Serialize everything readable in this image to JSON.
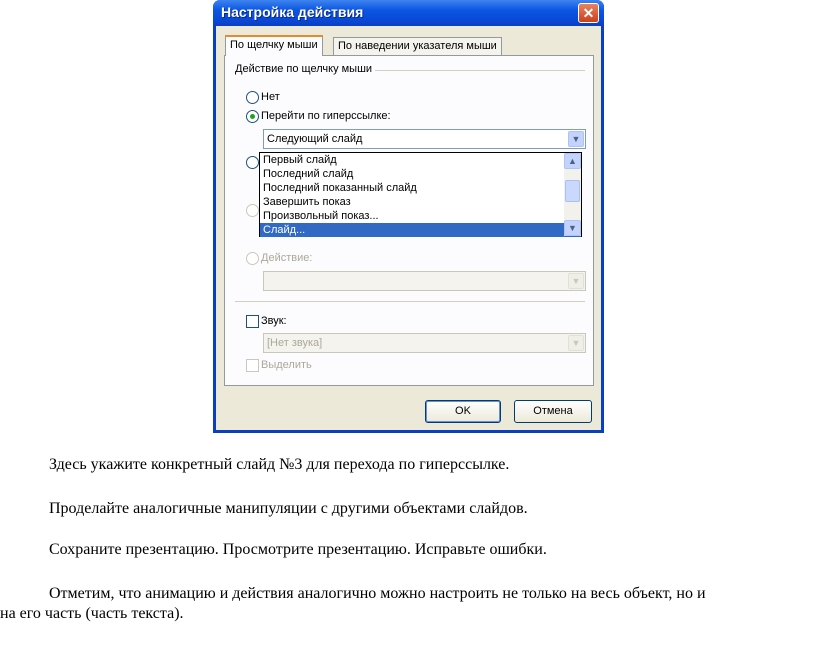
{
  "dialog": {
    "title": "Настройка действия",
    "tabs": [
      "По щелчку мыши",
      "По наведении указателя мыши"
    ],
    "group_label": "Действие по щелчку мыши",
    "radio_none": "Нет",
    "radio_hyperlink": "Перейти по гиперссылке:",
    "hyperlink_value": "Следующий слайд",
    "dropdown_items": [
      "Первый слайд",
      "Последний слайд",
      "Последний показанный слайд",
      "Завершить показ",
      "Произвольный показ...",
      "Слайд..."
    ],
    "selected_dropdown_index": 5,
    "radio_action": "Действие:",
    "sound_label": "Звук:",
    "sound_value": "[Нет звука]",
    "highlight_label": "Выделить",
    "ok_label": "OK",
    "cancel_label": "Отмена",
    "close_glyph": "✕"
  },
  "text": {
    "p1": "Здесь укажите конкретный слайд №3 для перехода по гиперссылке.",
    "p2": "Проделайте аналогичные манипуляции с другими объектами слайдов.",
    "p3": "Сохраните презентацию. Просмотрите презентацию. Исправьте ошибки.",
    "p4_line1": "Отметим, что анимацию и действия аналогично можно настроить не только на весь объект, но и",
    "p4_line2": "на его часть (часть текста)."
  }
}
